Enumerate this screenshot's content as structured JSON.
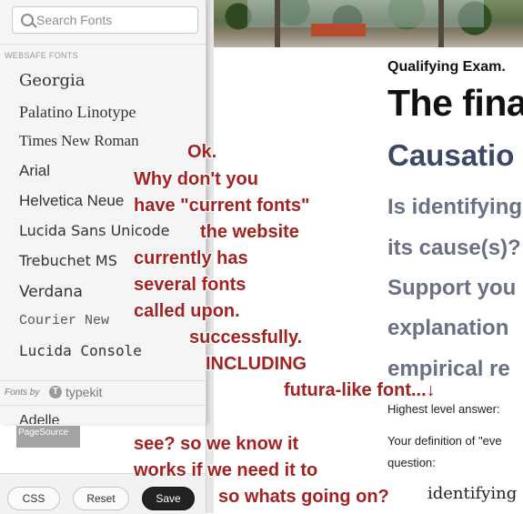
{
  "font_panel": {
    "search": {
      "placeholder": "Search Fonts",
      "value": ""
    },
    "websafe_heading": "WEBSAFE FONTS",
    "websafe_fonts": [
      "Georgia",
      "Palatino Linotype",
      "Times New Roman",
      "Arial",
      "Helvetica Neue",
      "Lucida Sans Unicode",
      "Trebuchet MS",
      "Verdana",
      "Courier New",
      "Lucida Console"
    ],
    "typekit": {
      "fonts_by": "Fonts by",
      "logo_glyph": "T",
      "brand": "typekit"
    },
    "typekit_fonts": [
      "Adelle"
    ],
    "page_source_label": "PageSource"
  },
  "toolbar": {
    "css_label": "CSS",
    "reset_label": "Reset",
    "save_label": "Save"
  },
  "webpage": {
    "subheading": "Qualifying Exam.",
    "title": "The fina",
    "section": "Causatio",
    "question_lines": [
      "Is identifying",
      "its cause(s)?",
      "Support you",
      "explanation",
      "empirical re"
    ],
    "highest_answer": "Highest level answer:",
    "definition_line_1": "Your definition of \"eve",
    "definition_line_2": "question:",
    "serif_line": "identifying"
  },
  "annotations": [
    "Ok.",
    "Why don't you",
    "have \"current fonts\"",
    "the website",
    "currently has",
    "several fonts",
    "called upon.",
    "successfully.",
    "INCLUDING",
    "futura-like font...↓",
    "see? so we know it",
    "works if we need it to",
    "so whats going on?"
  ],
  "colors": {
    "annotation": "#a32222",
    "panel_bg": "#f5f5f5",
    "save_button": "#222222",
    "heading_blue": "#3d4766"
  }
}
